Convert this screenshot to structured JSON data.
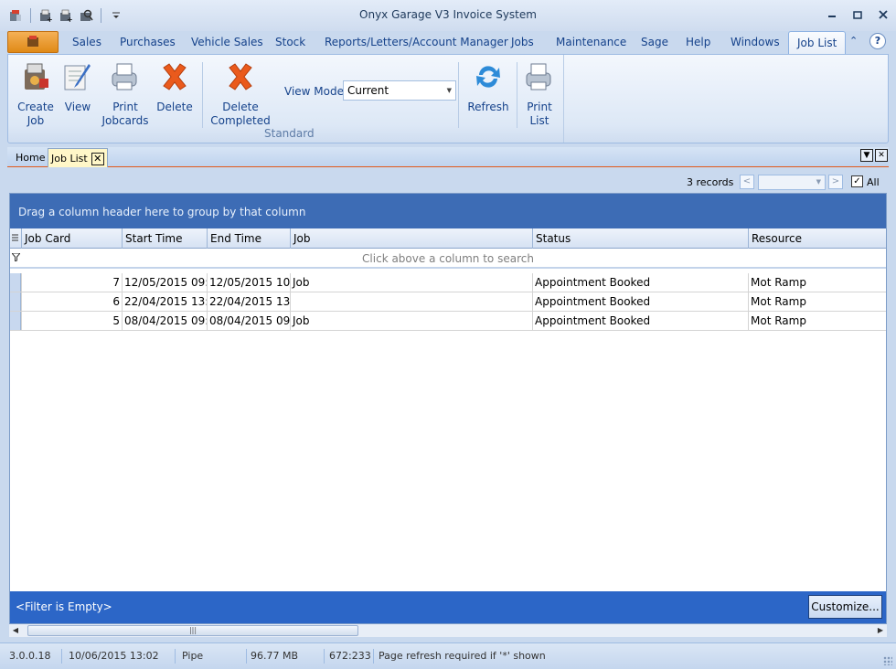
{
  "window": {
    "title": "Onyx Garage V3 Invoice System"
  },
  "ribbon_tabs": [
    "Sales",
    "Purchases",
    "Vehicle Sales",
    "Stock",
    "Reports/Letters/Account Manager",
    "Jobs",
    "Maintenance",
    "Sage",
    "Help",
    "Windows",
    "Job List"
  ],
  "help_label": "?",
  "ribbon": {
    "create_job": "Create\nJob",
    "view": "View",
    "print_jobcards": "Print\nJobcards",
    "delete": "Delete",
    "delete_completed": "Delete\nCompleted",
    "view_mode_label": "View Mode",
    "view_mode_value": "Current",
    "refresh": "Refresh",
    "print_list": "Print\nList",
    "group_label": "Standard"
  },
  "doc_tabs": {
    "home": "Home",
    "job_list": "Job List"
  },
  "records": {
    "count": "3 records",
    "all_label": "All"
  },
  "grid": {
    "group_hint": "Drag a column header here to group by that column",
    "columns": [
      "Job Card",
      "Start Time",
      "End Time",
      "Job",
      "Status",
      "Resource"
    ],
    "filter_hint": "Click above a column to search",
    "rows": [
      {
        "job_card": "7",
        "start": "12/05/2015 09:",
        "end": "12/05/2015 10:",
        "job": "Job",
        "status": "Appointment Booked",
        "resource": "Mot Ramp"
      },
      {
        "job_card": "6",
        "start": "22/04/2015 13:",
        "end": "22/04/2015 13:",
        "job": "",
        "status": "Appointment Booked",
        "resource": "Mot Ramp"
      },
      {
        "job_card": "5",
        "start": "08/04/2015 09:",
        "end": "08/04/2015 09:",
        "job": "Job",
        "status": "Appointment Booked",
        "resource": "Mot Ramp"
      }
    ],
    "filter_status": "<Filter is Empty>",
    "customize": "Customize..."
  },
  "status": {
    "version": "3.0.0.18",
    "datetime": "10/06/2015 13:02",
    "user": "Pipe",
    "memory": "96.77 MB",
    "coords": "672:233",
    "message": "Page refresh required if '*' shown"
  },
  "colors": {
    "accent": "#2c66c7",
    "group_bar": "#3d6cb5",
    "app_button": "#e8941f"
  }
}
